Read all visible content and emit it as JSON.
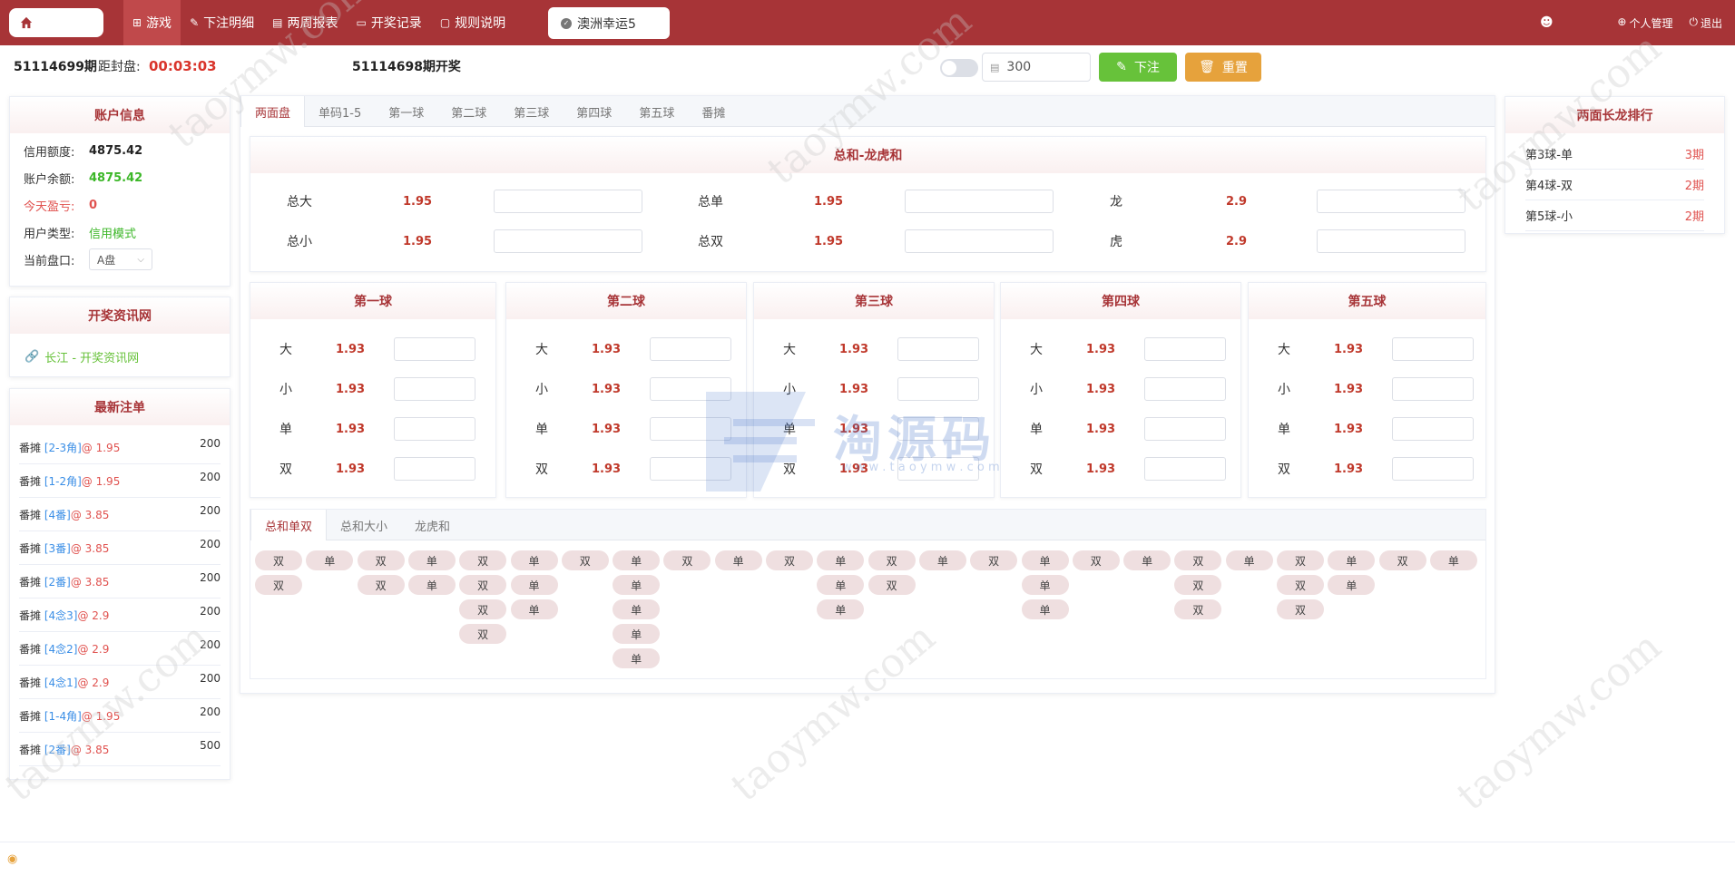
{
  "nav": {
    "items": [
      {
        "icon": "grid-icon",
        "glyph": "⊞",
        "label": "游戏",
        "active": true
      },
      {
        "icon": "pencil-icon",
        "glyph": "✎",
        "label": "下注明细"
      },
      {
        "icon": "calendar-icon",
        "glyph": "▤",
        "label": "两周报表"
      },
      {
        "icon": "monitor-icon",
        "glyph": "▭",
        "label": "开奖记录"
      },
      {
        "icon": "chat-icon",
        "glyph": "▢",
        "label": "规则说明"
      }
    ],
    "game_tab": "澳洲幸运5",
    "user_menu": [
      {
        "icon": "globe-icon",
        "glyph": "⊕",
        "label": "个人管理"
      },
      {
        "icon": "power-icon",
        "glyph": "⏻",
        "label": "退出"
      }
    ]
  },
  "status": {
    "period": "51114699期",
    "countdown_label": "距封盘:",
    "countdown": "00:03:03",
    "last_draw": "51114698期开奖",
    "amount": "300",
    "bet_label": "下注",
    "reset_label": "重置"
  },
  "account": {
    "title": "账户信息",
    "credit_label": "信用额度:",
    "credit": "4875.42",
    "balance_label": "账户余额:",
    "balance": "4875.42",
    "profit_label": "今天盈亏:",
    "profit": "0",
    "type_label": "用户类型:",
    "type": "信用模式",
    "plate_label": "当前盘口:",
    "plate": "A盘"
  },
  "info": {
    "title": "开奖资讯网",
    "link": "长江 - 开奖资讯网"
  },
  "latest": {
    "title": "最新注单",
    "rows": [
      {
        "type": "番摊 ",
        "num": "[2-3角]",
        "odds": "@ 1.95",
        "amount": "200"
      },
      {
        "type": "番摊 ",
        "num": "[1-2角]",
        "odds": "@ 1.95",
        "amount": "200"
      },
      {
        "type": "番摊 ",
        "num": "[4番]",
        "odds": "@ 3.85",
        "amount": "200"
      },
      {
        "type": "番摊 ",
        "num": "[3番]",
        "odds": "@ 3.85",
        "amount": "200"
      },
      {
        "type": "番摊 ",
        "num": "[2番]",
        "odds": "@ 3.85",
        "amount": "200"
      },
      {
        "type": "番摊 ",
        "num": "[4念3]",
        "odds": "@ 2.9",
        "amount": "200"
      },
      {
        "type": "番摊 ",
        "num": "[4念2]",
        "odds": "@ 2.9",
        "amount": "200"
      },
      {
        "type": "番摊 ",
        "num": "[4念1]",
        "odds": "@ 2.9",
        "amount": "200"
      },
      {
        "type": "番摊 ",
        "num": "[1-4角]",
        "odds": "@ 1.95",
        "amount": "200"
      },
      {
        "type": "番摊 ",
        "num": "[2番]",
        "odds": "@ 3.85",
        "amount": "500"
      }
    ]
  },
  "play_tabs": [
    "两面盘",
    "单码1-5",
    "第一球",
    "第二球",
    "第三球",
    "第四球",
    "第五球",
    "番摊"
  ],
  "sum_section": {
    "title": "总和-龙虎和",
    "options": [
      {
        "name": "总大",
        "odds": "1.95"
      },
      {
        "name": "总单",
        "odds": "1.95"
      },
      {
        "name": "龙",
        "odds": "2.9"
      },
      {
        "name": "总小",
        "odds": "1.95"
      },
      {
        "name": "总双",
        "odds": "1.95"
      },
      {
        "name": "虎",
        "odds": "2.9"
      }
    ]
  },
  "balls": [
    {
      "title": "第一球",
      "options": [
        {
          "name": "大",
          "odds": "1.93"
        },
        {
          "name": "小",
          "odds": "1.93"
        },
        {
          "name": "单",
          "odds": "1.93"
        },
        {
          "name": "双",
          "odds": "1.93"
        }
      ]
    },
    {
      "title": "第二球",
      "options": [
        {
          "name": "大",
          "odds": "1.93"
        },
        {
          "name": "小",
          "odds": "1.93"
        },
        {
          "name": "单",
          "odds": "1.93"
        },
        {
          "name": "双",
          "odds": "1.93"
        }
      ]
    },
    {
      "title": "第三球",
      "options": [
        {
          "name": "大",
          "odds": "1.93"
        },
        {
          "name": "小",
          "odds": "1.93"
        },
        {
          "name": "单",
          "odds": "1.93"
        },
        {
          "name": "双",
          "odds": "1.93"
        }
      ]
    },
    {
      "title": "第四球",
      "options": [
        {
          "name": "大",
          "odds": "1.93"
        },
        {
          "name": "小",
          "odds": "1.93"
        },
        {
          "name": "单",
          "odds": "1.93"
        },
        {
          "name": "双",
          "odds": "1.93"
        }
      ]
    },
    {
      "title": "第五球",
      "options": [
        {
          "name": "大",
          "odds": "1.93"
        },
        {
          "name": "小",
          "odds": "1.93"
        },
        {
          "name": "单",
          "odds": "1.93"
        },
        {
          "name": "双",
          "odds": "1.93"
        }
      ]
    }
  ],
  "road": {
    "tabs": [
      "总和单双",
      "总和大小",
      "龙虎和"
    ],
    "columns": [
      [
        "双",
        "双"
      ],
      [
        "单"
      ],
      [
        "双",
        "双"
      ],
      [
        "单",
        "单"
      ],
      [
        "双",
        "双",
        "双",
        "双"
      ],
      [
        "单",
        "单",
        "单"
      ],
      [
        "双"
      ],
      [
        "单",
        "单",
        "单",
        "单",
        "单"
      ],
      [
        "双"
      ],
      [
        "单"
      ],
      [
        "双"
      ],
      [
        "单",
        "单",
        "单"
      ],
      [
        "双",
        "双"
      ],
      [
        "单"
      ],
      [
        "双"
      ],
      [
        "单",
        "单",
        "单"
      ],
      [
        "双"
      ],
      [
        "单"
      ],
      [
        "双",
        "双",
        "双"
      ],
      [
        "单"
      ],
      [
        "双",
        "双",
        "双"
      ],
      [
        "单",
        "单"
      ],
      [
        "双"
      ],
      [
        "单"
      ]
    ]
  },
  "ranking": {
    "title": "两面长龙排行",
    "rows": [
      {
        "name": "第3球-单",
        "value": "3期"
      },
      {
        "name": "第4球-双",
        "value": "2期"
      },
      {
        "name": "第5球-小",
        "value": "2期"
      }
    ]
  },
  "watermark": {
    "text": "taoymw.com",
    "logo_text": "淘源码",
    "logo_sub": "w w w . t a o y m w . c o m",
    "logo_color": "#3f6fc8"
  },
  "footer": {
    "icon": "speaker-icon",
    "glyph": "◉"
  }
}
